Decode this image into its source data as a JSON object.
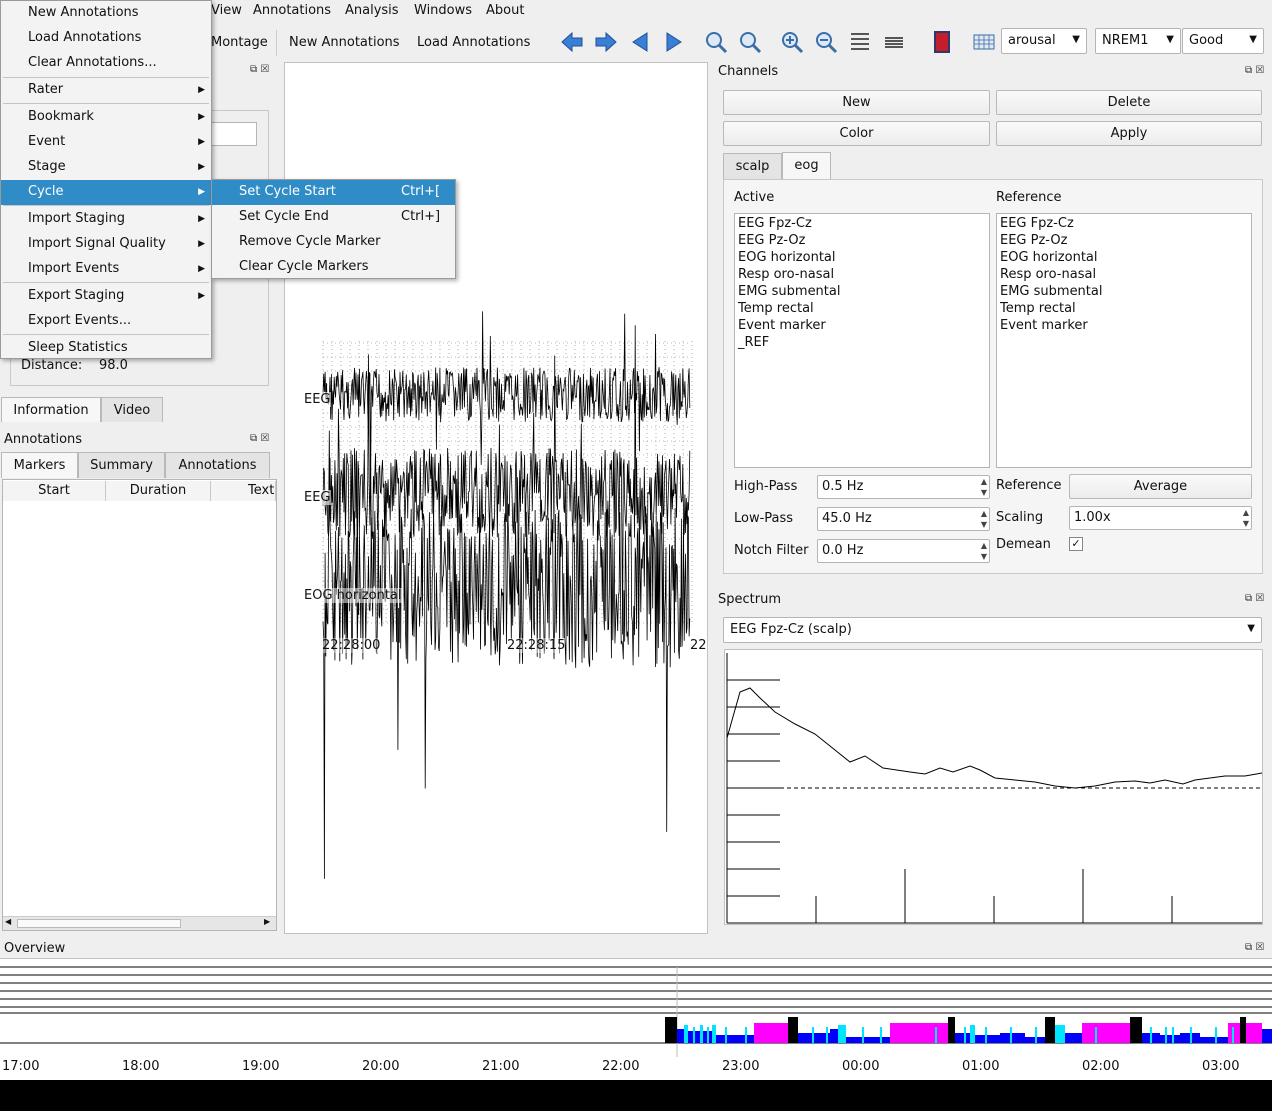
{
  "menubar": [
    "View",
    "Annotations",
    "Analysis",
    "Windows",
    "About"
  ],
  "toolbar": {
    "montage": "Montage",
    "new_annotations": "New Annotations",
    "load_annotations": "Load Annotations",
    "event_select": "arousal",
    "stage_select": "NREM1",
    "quality_select": "Good"
  },
  "file_menu": {
    "items": [
      "New Annotations",
      "Load Annotations",
      "Clear Annotations...",
      "Rater",
      "Bookmark",
      "Event",
      "Stage",
      "Cycle",
      "Import Staging",
      "Import Signal Quality",
      "Import Events",
      "Export Staging",
      "Export Events...",
      "Sleep Statistics"
    ]
  },
  "cycle_submenu": {
    "items": [
      {
        "label": "Set Cycle Start",
        "shortcut": "Ctrl+["
      },
      {
        "label": "Set Cycle End",
        "shortcut": "Ctrl+]"
      },
      {
        "label": "Remove Cycle Marker",
        "shortcut": ""
      },
      {
        "label": "Clear Cycle Markers",
        "shortcut": ""
      }
    ]
  },
  "info": {
    "distance_label": "Distance:",
    "distance_value": "98.0",
    "tabs": [
      "Information",
      "Video"
    ]
  },
  "annotations": {
    "title": "Annotations",
    "tabs": [
      "Markers",
      "Summary",
      "Annotations"
    ],
    "columns": [
      "Start",
      "Duration",
      "Text"
    ]
  },
  "traces": {
    "labels": [
      "EEG",
      "EEG",
      "EOG horizontal"
    ],
    "times": [
      "22:28:00",
      "22:28:15",
      "22"
    ]
  },
  "channels": {
    "title": "Channels",
    "buttons": [
      "New",
      "Delete",
      "Color",
      "Apply"
    ],
    "tabs": [
      "scalp",
      "eog"
    ],
    "active_label": "Active",
    "reference_label": "Reference",
    "active": [
      "EEG Fpz-Cz",
      "EEG Pz-Oz",
      "EOG horizontal",
      "Resp oro-nasal",
      "EMG submental",
      "Temp rectal",
      "Event marker",
      "_REF"
    ],
    "reference": [
      "EEG Fpz-Cz",
      "EEG Pz-Oz",
      "EOG horizontal",
      "Resp oro-nasal",
      "EMG submental",
      "Temp rectal",
      "Event marker"
    ],
    "high_pass_label": "High-Pass",
    "high_pass": "0.5 Hz",
    "low_pass_label": "Low-Pass",
    "low_pass": "45.0 Hz",
    "notch_label": "Notch Filter",
    "notch": "0.0 Hz",
    "reference_opt_label": "Reference",
    "reference_btn": "Average",
    "scaling_label": "Scaling",
    "scaling": "1.00x",
    "demean_label": "Demean",
    "demean_checked": true
  },
  "spectrum": {
    "title": "Spectrum",
    "channel": "EEG Fpz-Cz (scalp)"
  },
  "overview": {
    "title": "Overview",
    "times": [
      "17:00",
      "18:00",
      "19:00",
      "20:00",
      "21:00",
      "22:00",
      "23:00",
      "00:00",
      "01:00",
      "02:00",
      "03:00"
    ]
  },
  "colors": {
    "accent": "#308cc6",
    "rem": "#ff00ff",
    "nrem": "#0000ff",
    "light": "#00e5ff",
    "wake": "#000000"
  }
}
